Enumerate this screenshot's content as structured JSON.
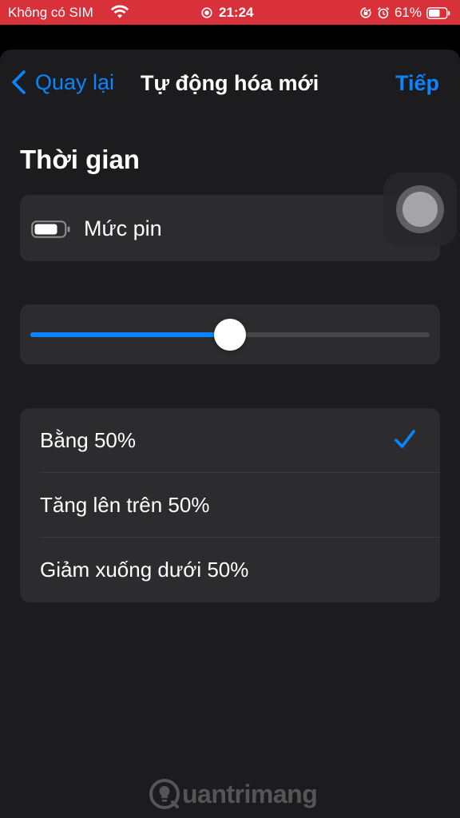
{
  "status_bar": {
    "carrier": "Không có SIM",
    "time": "21:24",
    "battery_percent": "61%",
    "icons": [
      "wifi-icon",
      "screen-recording-icon",
      "orientation-lock-icon",
      "alarm-icon",
      "battery-icon"
    ],
    "background_color": "#d8313a"
  },
  "nav": {
    "back_label": "Quay lại",
    "title": "Tự động hóa mới",
    "next_label": "Tiếp"
  },
  "section": {
    "title": "Thời gian"
  },
  "battery_row": {
    "icon": "battery-level-icon",
    "label": "Mức pin"
  },
  "slider": {
    "value_fraction": 0.5
  },
  "options": [
    {
      "label": "Bằng 50%",
      "selected": true
    },
    {
      "label": "Tăng lên trên 50%",
      "selected": false
    },
    {
      "label": "Giảm xuống dưới 50%",
      "selected": false
    }
  ],
  "watermark": {
    "text": "uantrimang"
  },
  "colors": {
    "accent": "#0a84ff",
    "sheet_background": "#1c1c1e",
    "card_background": "#2c2c2e"
  }
}
